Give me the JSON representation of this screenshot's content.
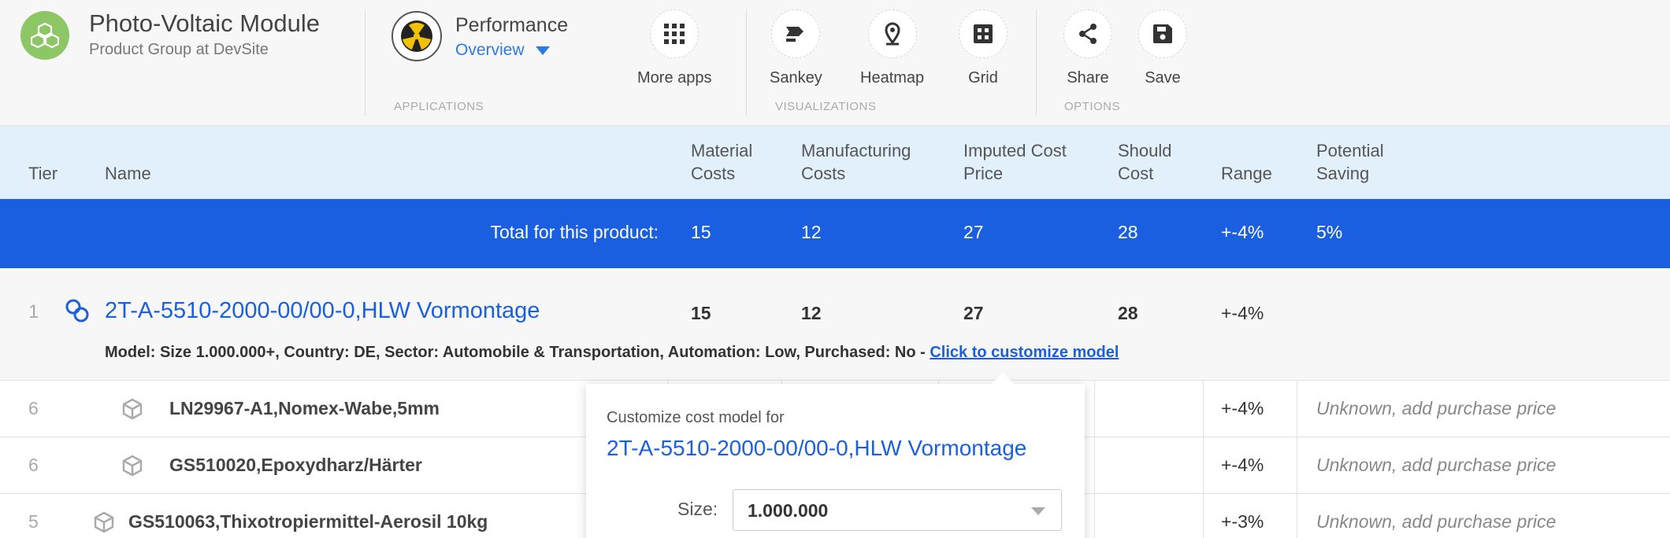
{
  "product": {
    "title": "Photo-Voltaic Module",
    "subtitle": "Product Group at DevSite"
  },
  "applications": {
    "name": "Performance",
    "view": "Overview",
    "group_label": "APPLICATIONS",
    "more_apps": "More apps"
  },
  "visualizations": {
    "group_label": "VISUALIZATIONS",
    "sankey": "Sankey",
    "heatmap": "Heatmap",
    "grid": "Grid"
  },
  "options": {
    "group_label": "OPTIONS",
    "share": "Share",
    "save": "Save"
  },
  "table": {
    "headers": {
      "tier": "Tier",
      "name": "Name",
      "material_1": "Material",
      "material_2": "Costs",
      "manufacturing_1": "Manufacturing",
      "manufacturing_2": "Costs",
      "imputed_1": "Imputed Cost",
      "imputed_2": "Price",
      "should_1": "Should",
      "should_2": "Cost",
      "range": "Range",
      "saving_1": "Potential",
      "saving_2": "Saving"
    },
    "total": {
      "label": "Total for this product:",
      "material": "15",
      "manufacturing": "12",
      "imputed": "27",
      "should": "28",
      "range": "+-4%",
      "saving": "5%"
    },
    "main_row": {
      "tier": "1",
      "name": "2T-A-5510-2000-00/00-0,HLW Vormontage",
      "material": "15",
      "manufacturing": "12",
      "imputed": "27",
      "should": "28",
      "range": "+-4%",
      "model_text": "Model: Size 1.000.000+, Country: DE, Sector: Automobile & Transportation, Automation: Low, Purchased: No - ",
      "model_link": "Click to customize model"
    },
    "rows": [
      {
        "tier": "6",
        "name": "LN29967-A1,Nomex-Wabe,5mm",
        "range": "+-4%",
        "saving": "Unknown, add purchase price"
      },
      {
        "tier": "6",
        "name": "GS510020,Epoxydharz/Härter",
        "range": "+-4%",
        "saving": "Unknown, add purchase price"
      },
      {
        "tier": "5",
        "name": "GS510063,Thixotropiermittel-Aerosil 10kg",
        "range": "+-3%",
        "saving": "Unknown, add purchase price"
      }
    ]
  },
  "popover": {
    "title": "Customize cost model for",
    "name": "2T-A-5510-2000-00/00-0,HLW Vormontage",
    "size_label": "Size:",
    "size_value": "1.000.000"
  },
  "colors": {
    "accent": "#1a5fe0",
    "link": "#2c7be5",
    "logo": "#8cc665",
    "header_bg": "#e2f0fb"
  }
}
